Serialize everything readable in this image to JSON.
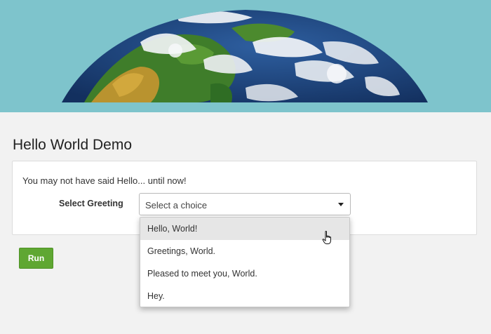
{
  "page": {
    "title": "Hello World Demo",
    "intro_text": "You may not have said Hello... until now!"
  },
  "form": {
    "field_label": "Select Greeting",
    "select_value": "Select a choice",
    "options": [
      "Hello, World!",
      "Greetings, World.",
      "Pleased to meet you, World.",
      "Hey."
    ],
    "hovered_option_index": 0
  },
  "actions": {
    "run_label": "Run"
  },
  "colors": {
    "banner_bg": "#7ec4cc",
    "run_button": "#5fa732",
    "ocean": "#1d3f7a"
  },
  "icons": {
    "banner_image": "earth-globe",
    "select_caret": "caret-down-icon",
    "pointer": "hand-pointer-icon"
  }
}
